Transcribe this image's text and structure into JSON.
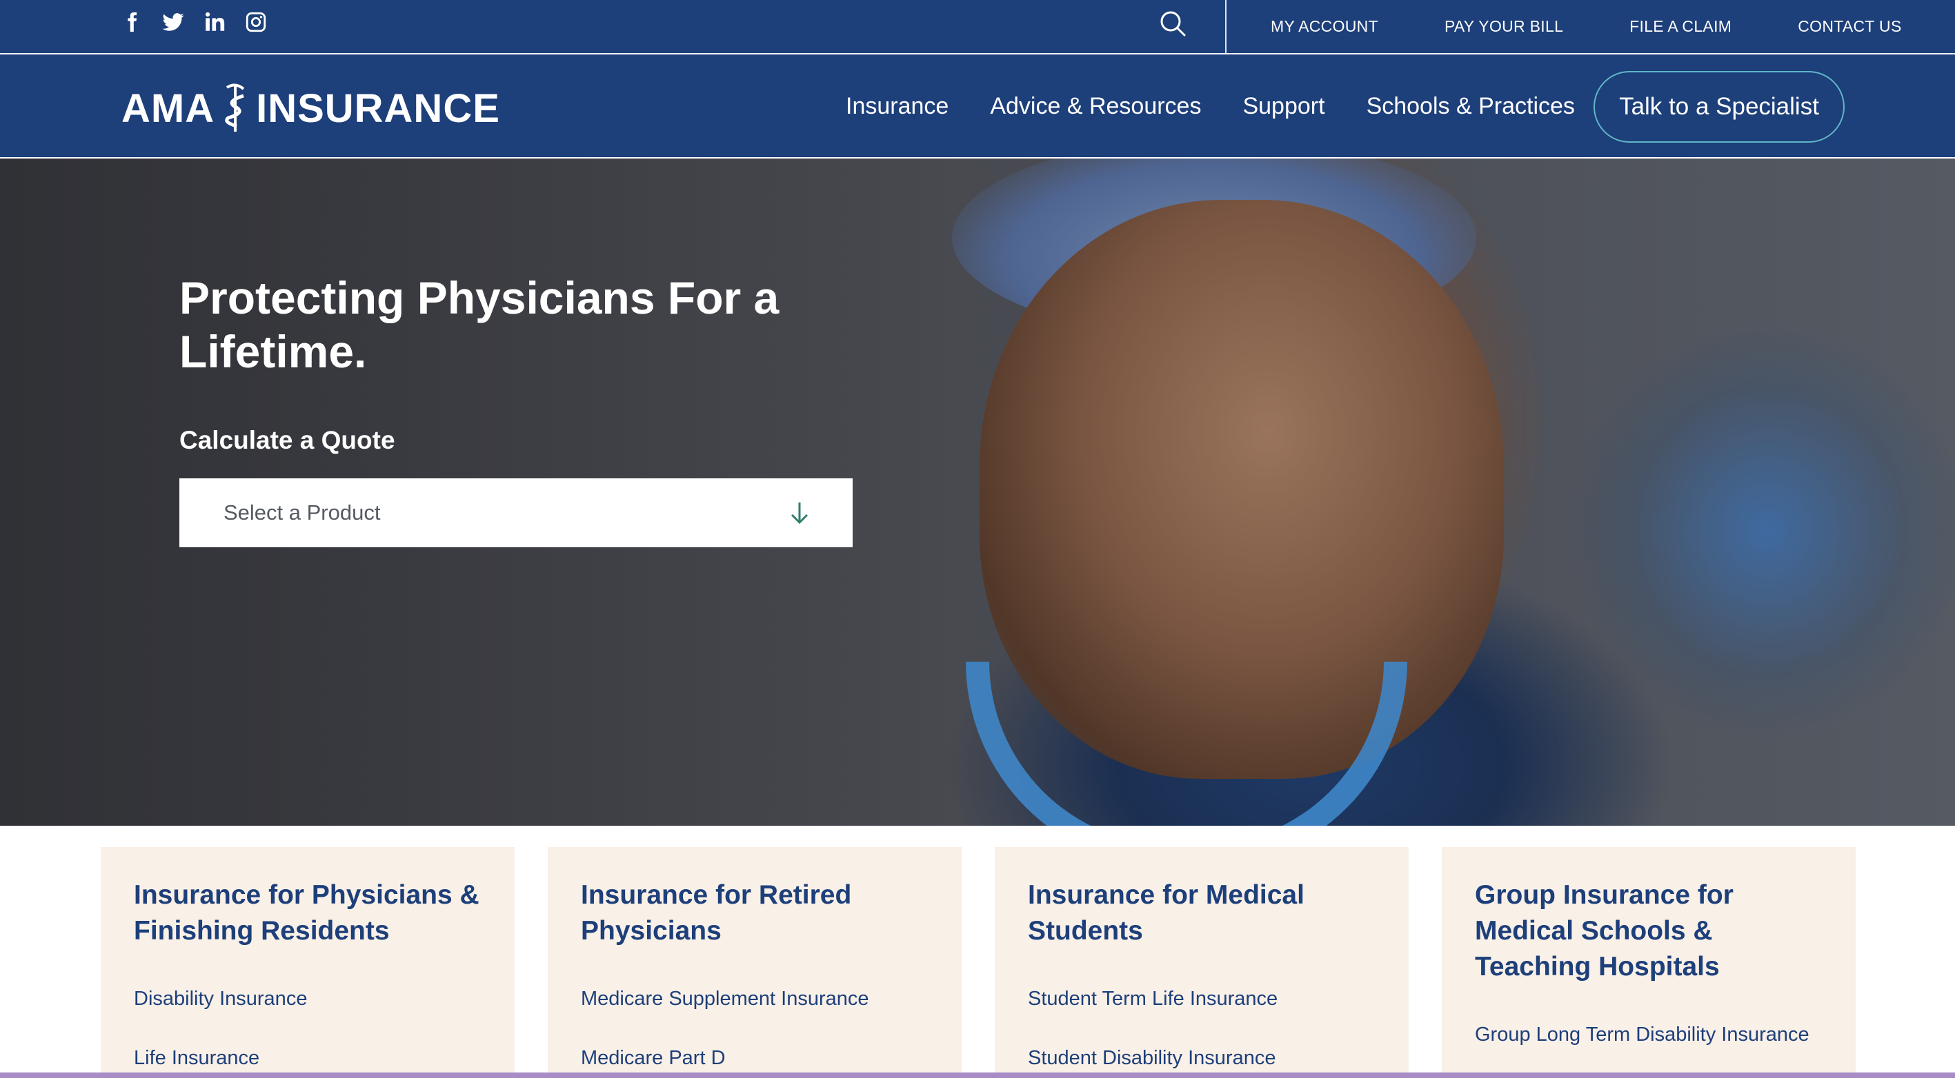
{
  "utility_bar": {
    "social_icons": [
      "facebook-icon",
      "twitter-icon",
      "linkedin-icon",
      "instagram-icon"
    ],
    "search_icon": "search-icon",
    "links": [
      "MY ACCOUNT",
      "PAY YOUR BILL",
      "FILE A CLAIM",
      "CONTACT US"
    ]
  },
  "header": {
    "logo_left": "AMA",
    "logo_right": "INSURANCE",
    "nav": [
      "Insurance",
      "Advice & Resources",
      "Support",
      "Schools & Practices"
    ],
    "cta": "Talk to a Specialist"
  },
  "hero": {
    "title": "Protecting Physicians For a Lifetime.",
    "quote_label": "Calculate a Quote",
    "select_value": "Select a Product",
    "select_icon": "arrow-down-icon"
  },
  "cards": [
    {
      "title": "Insurance for Physicians & Finishing Residents",
      "links": [
        "Disability Insurance",
        "Life Insurance"
      ]
    },
    {
      "title": "Insurance for Retired Physicians",
      "links": [
        "Medicare Supplement Insurance",
        "Medicare Part D"
      ]
    },
    {
      "title": "Insurance for Medical Students",
      "links": [
        "Student Term Life Insurance",
        "Student Disability Insurance"
      ]
    },
    {
      "title": "Group Insurance for Medical Schools & Teaching Hospitals",
      "links": [
        "Group Long Term Disability Insurance"
      ]
    }
  ],
  "colors": {
    "brand_navy": "#1d3f7a",
    "cta_border": "#5fb6c8",
    "card_bg": "#f9f0e8",
    "select_arrow": "#2f7d6e"
  }
}
